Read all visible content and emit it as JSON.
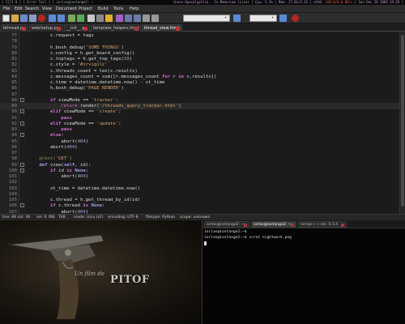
{
  "sysbar": {
    "left": "[ 2][3 8 ] [ Error Tail ] ] iorlas@iostange2: ~",
    "right_a": "zhuze Apocalyptica - In Memoriam (Live) [ Cpu: 5.2% | Mem: 17.6G/3.2G ] eth0: ",
    "right_b": "100.0/0.0 KB/s",
    "right_c": " [ Sun Dec 20 2009 19:28 ]"
  },
  "menu": {
    "items": [
      "File",
      "Edit",
      "Search",
      "View",
      "Document",
      "Project",
      "Build",
      "Tools",
      "Help"
    ]
  },
  "toolbar": {
    "combo_left_value": "",
    "combo_right_value": ""
  },
  "tabs": [
    {
      "label": "bthread.py",
      "active": false
    },
    {
      "label": "web/setup.py",
      "active": false
    },
    {
      "label": "__init__.py",
      "active": false
    },
    {
      "label": "template_helpers.html",
      "active": false
    },
    {
      "label": "thread_view.html",
      "active": true
    }
  ],
  "editor": {
    "lines": [
      {
        "n": "77",
        "fold": "",
        "html": "        c.request = tags"
      },
      {
        "n": "78",
        "fold": "",
        "html": ""
      },
      {
        "n": "79",
        "fold": "",
        "html": "        h.bosh_debug(<span class=\"str\">'SOME THINGS'</span>)"
      },
      {
        "n": "80",
        "fold": "",
        "html": "        c.config = h.get_board_config()"
      },
      {
        "n": "81",
        "fold": "",
        "html": "        c.toptags = h.get_top_tags(<span class=\"num\">10</span>)"
      },
      {
        "n": "82",
        "fold": "",
        "html": "        c.style = <span class=\"str\">'#irvigilz'</span>"
      },
      {
        "n": "83",
        "fold": "",
        "html": "        c.threads_count = len(c.results)"
      },
      {
        "n": "84",
        "fold": "",
        "html": "        c.messages_count = sum([r.messages_count <span class=\"kw\">for</span> r <span class=\"kw\">in</span> c.results])"
      },
      {
        "n": "85",
        "fold": "",
        "html": "        c.time = datetime.datetime.now() - st_time"
      },
      {
        "n": "86",
        "fold": "",
        "html": "        h.bosh_debug(<span class=\"str\">'PAGE RENDER'</span>)"
      },
      {
        "n": "87",
        "fold": "",
        "html": ""
      },
      {
        "n": "88",
        "fold": "-",
        "html": "        <span class=\"kw\">if</span> viewMode == <span class=\"str\">'tracker'</span>:"
      },
      {
        "n": "89",
        "fold": "",
        "html": "            <span class=\"ret\">return</span> render(<span class=\"str\">'/threads_query_tracker.html'</span>)"
      },
      {
        "n": "90",
        "fold": "-",
        "html": "        <span class=\"kw\">elif</span> viewMode == <span class=\"str\">'create'</span>:"
      },
      {
        "n": "91",
        "fold": "",
        "html": "            <span class=\"kw\">pass</span>"
      },
      {
        "n": "92",
        "fold": "-",
        "html": "        <span class=\"kw\">elif</span> viewMode == <span class=\"str\">'update'</span>:"
      },
      {
        "n": "93",
        "fold": "",
        "html": "            <span class=\"kw\">pass</span>"
      },
      {
        "n": "94",
        "fold": "-",
        "html": "        <span class=\"kw\">else</span>:"
      },
      {
        "n": "95",
        "fold": "",
        "html": "            abort(<span class=\"num\">404</span>)"
      },
      {
        "n": "96",
        "fold": "",
        "html": "        abort(<span class=\"num\">404</span>)"
      },
      {
        "n": "97",
        "fold": "",
        "html": ""
      },
      {
        "n": "98",
        "fold": "",
        "html": "    <span class=\"dec\">@rest(<span class=\"str\">'GET'</span>)</span>"
      },
      {
        "n": "99",
        "fold": "-",
        "html": "    <span class=\"kw2\">def</span> view(<span class=\"kw2\">self</span>, id):"
      },
      {
        "n": "100",
        "fold": "-",
        "html": "        <span class=\"kw\">if</span> id <span class=\"kw\">is</span> <span class=\"kw2\">None</span>:"
      },
      {
        "n": "101",
        "fold": "",
        "html": "            abort(<span class=\"num\">404</span>)"
      },
      {
        "n": "102",
        "fold": "",
        "html": ""
      },
      {
        "n": "103",
        "fold": "",
        "html": "        st_time = datetime.datetime.now()"
      },
      {
        "n": "104",
        "fold": "",
        "html": ""
      },
      {
        "n": "105",
        "fold": "",
        "html": "        c.thread = h.get_thread_by_id(id)"
      },
      {
        "n": "106",
        "fold": "-",
        "html": "        <span class=\"kw\">if</span> c.thread <span class=\"kw\">is</span> <span class=\"kw2\">None</span>:"
      },
      {
        "n": "107",
        "fold": "",
        "html": "            abort(<span class=\"num\">404</span>)"
      }
    ]
  },
  "status": {
    "line": "line: 89 col: 39",
    "sel": "sel: 0",
    "ins": "INS",
    "tab": "TAB",
    "mode": "mode: Unix (LF)",
    "encoding": "encoding: UTF-8",
    "filetype": "filetype: Python",
    "scope": "scope: unknown"
  },
  "wallpaper": {
    "credit": "Un film de",
    "title": "PITOF"
  },
  "terminal": {
    "tabs": [
      {
        "label": "iorlas@iostange2: ~",
        "active": false
      },
      {
        "label": "iorlas@iostange2: ~",
        "active": true
      },
      {
        "label": "ncmpc++ ver. 0.3.4",
        "active": false
      }
    ],
    "line1": "iorlas@iostange2:~$",
    "line2": "iorlas@iostange2:~$ scrot nightwork.png"
  },
  "colors": {
    "accent_red": "#e55",
    "editor_bg": "#1b1b1b",
    "string": "#d7a06a",
    "keyword": "#d070d0"
  }
}
